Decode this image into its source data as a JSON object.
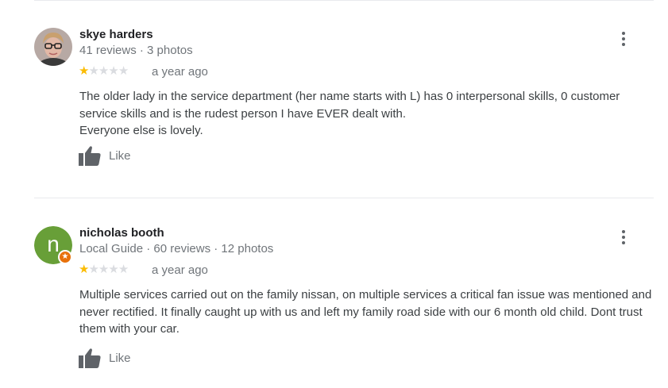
{
  "reviews": [
    {
      "reviewer": "skye harders",
      "meta": "41 reviews · 3 photos",
      "rating": 1,
      "max_rating": 5,
      "time": "a year ago",
      "text": [
        "The older lady in the service department (her name starts with L) has 0 interpersonal skills, 0 customer service skills and is the rudest person I have EVER dealt with.",
        "Everyone else is lovely."
      ],
      "like_label": "Like",
      "avatar_type": "photo"
    },
    {
      "reviewer": "nicholas booth",
      "meta": "Local Guide · 60 reviews · 12 photos",
      "rating": 1,
      "max_rating": 5,
      "time": "a year ago",
      "text": [
        "Multiple services carried out on the family nissan, on multiple services a critical fan issue was mentioned and never rectified. It finally caught up with us and left my family road side with our 6 month old child. Dont trust them with your car."
      ],
      "like_label": "Like",
      "avatar_type": "letter",
      "avatar_letter": "n",
      "avatar_color": "#689f38",
      "badge_icon": "local-guide-star-icon",
      "badge_color": "#e8710a"
    }
  ],
  "colors": {
    "star_filled": "#fbbc04",
    "star_empty": "#dadce0",
    "divider": "#e8eaed"
  },
  "icons": {
    "more": "more-vert-icon",
    "like": "thumb-up-icon"
  }
}
